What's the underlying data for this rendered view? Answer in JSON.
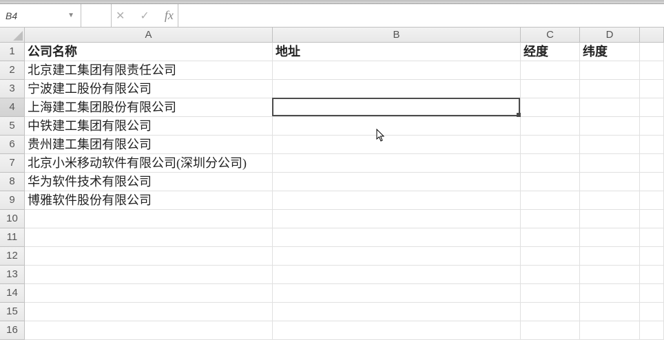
{
  "formula_bar": {
    "name_box": "B4",
    "input_value": ""
  },
  "columns": [
    "A",
    "B",
    "C",
    "D",
    ""
  ],
  "headers": {
    "A": "公司名称",
    "B": "地址",
    "C": "经度",
    "D": "纬度"
  },
  "rows": [
    "北京建工集团有限责任公司",
    "宁波建工股份有限公司",
    "上海建工集团股份有限公司",
    "中铁建工集团有限公司",
    "贵州建工集团有限公司",
    "北京小米移动软件有限公司(深圳分公司)",
    "华为软件技术有限公司",
    "博雅软件股份有限公司"
  ],
  "row_count": 16,
  "active_cell": "B4"
}
